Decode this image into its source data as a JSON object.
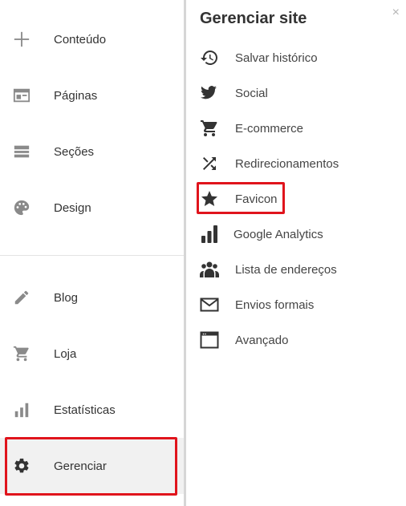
{
  "sidebar": {
    "items": [
      {
        "label": "Conteúdo",
        "icon": "plus-icon"
      },
      {
        "label": "Páginas",
        "icon": "page-layout-icon"
      },
      {
        "label": "Seções",
        "icon": "sections-icon"
      },
      {
        "label": "Design",
        "icon": "palette-icon"
      },
      {
        "label": "Blog",
        "icon": "pencil-icon"
      },
      {
        "label": "Loja",
        "icon": "cart-icon"
      },
      {
        "label": "Estatísticas",
        "icon": "bar-chart-icon"
      },
      {
        "label": "Gerenciar",
        "icon": "gear-icon",
        "active": true
      }
    ]
  },
  "panel": {
    "title": "Gerenciar site",
    "close_label": "×",
    "items": [
      {
        "label": "Salvar histórico",
        "icon": "history-icon"
      },
      {
        "label": "Social",
        "icon": "bird-icon"
      },
      {
        "label": "E-commerce",
        "icon": "cart-icon"
      },
      {
        "label": "Redirecionamentos",
        "icon": "shuffle-icon"
      },
      {
        "label": "Favicon",
        "icon": "star-icon"
      },
      {
        "label": "Google Analytics",
        "icon": "analytics-icon"
      },
      {
        "label": "Lista de endereços",
        "icon": "people-icon"
      },
      {
        "label": "Envios formais",
        "icon": "envelope-icon"
      },
      {
        "label": "Avançado",
        "icon": "window-icon"
      }
    ]
  },
  "colors": {
    "highlight": "#e0141c",
    "icon_gray": "#8a8a8a",
    "icon_dark": "#333333"
  }
}
